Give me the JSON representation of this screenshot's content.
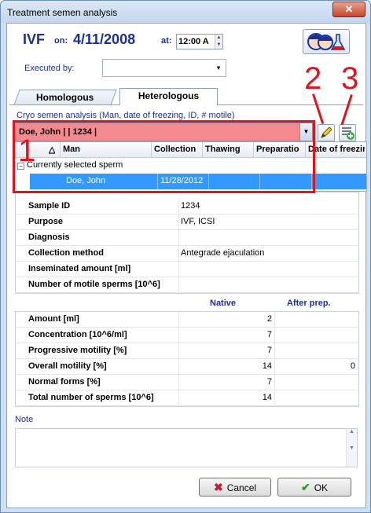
{
  "window": {
    "title": "Treatment semen analysis",
    "close_glyph": "✕"
  },
  "header": {
    "procedure": "IVF",
    "on_label": "on:",
    "date": "4/11/2008",
    "at_label": "at:",
    "time": "12:00 A",
    "logo_icon": "couple-lab-icon"
  },
  "executed_by": {
    "label": "Executed by:",
    "value": ""
  },
  "tabs": [
    {
      "label": "Homologous",
      "active": false
    },
    {
      "label": "Heterologous",
      "active": true
    }
  ],
  "cryo": {
    "label": "Cryo semen analysis (Man, date of freezing, ID, # motile)",
    "selected": "Doe, John |  | 1234 |",
    "combo_color": "#f28a8f"
  },
  "dropdown": {
    "sort_glyph": "△",
    "columns": [
      "Man",
      "Collection",
      "Thawing",
      "Preparatio",
      "Date of freezir"
    ],
    "group_toggle": "−",
    "group_label": "Currently selected sperm",
    "rows": [
      {
        "man": "Doe, John",
        "collection": "11/28/2012",
        "thawing": "",
        "preparation": "",
        "date_of_freezing": ""
      }
    ]
  },
  "annotations": {
    "box_label": "1",
    "edit_label": "2",
    "add_label": "3",
    "color": "#e0141c"
  },
  "details": [
    {
      "label": "Sample ID",
      "value": "1234"
    },
    {
      "label": "Purpose",
      "value": "IVF, ICSI"
    },
    {
      "label": "Diagnosis",
      "value": ""
    },
    {
      "label": "Collection method",
      "value": "Antegrade ejaculation"
    },
    {
      "label": "Inseminated amount [ml]",
      "value": ""
    },
    {
      "label": "Number of motile sperms [10^6]",
      "value": ""
    }
  ],
  "analysis": {
    "native_header": "Native",
    "after_header": "After prep.",
    "rows": [
      {
        "label": "Amount [ml]",
        "native": "2",
        "after": ""
      },
      {
        "label": "Concentration [10^6/ml]",
        "native": "7",
        "after": ""
      },
      {
        "label": "Progressive motility [%]",
        "native": "7",
        "after": ""
      },
      {
        "label": "Overall motility [%]",
        "native": "14",
        "after": "0"
      },
      {
        "label": "Normal forms [%]",
        "native": "7",
        "after": ""
      },
      {
        "label": "Total number of sperms [10^6]",
        "native": "14",
        "after": ""
      }
    ]
  },
  "note": {
    "label": "Note",
    "value": ""
  },
  "buttons": {
    "cancel": "Cancel",
    "cancel_glyph": "✖",
    "ok": "OK",
    "ok_glyph": "✔"
  }
}
